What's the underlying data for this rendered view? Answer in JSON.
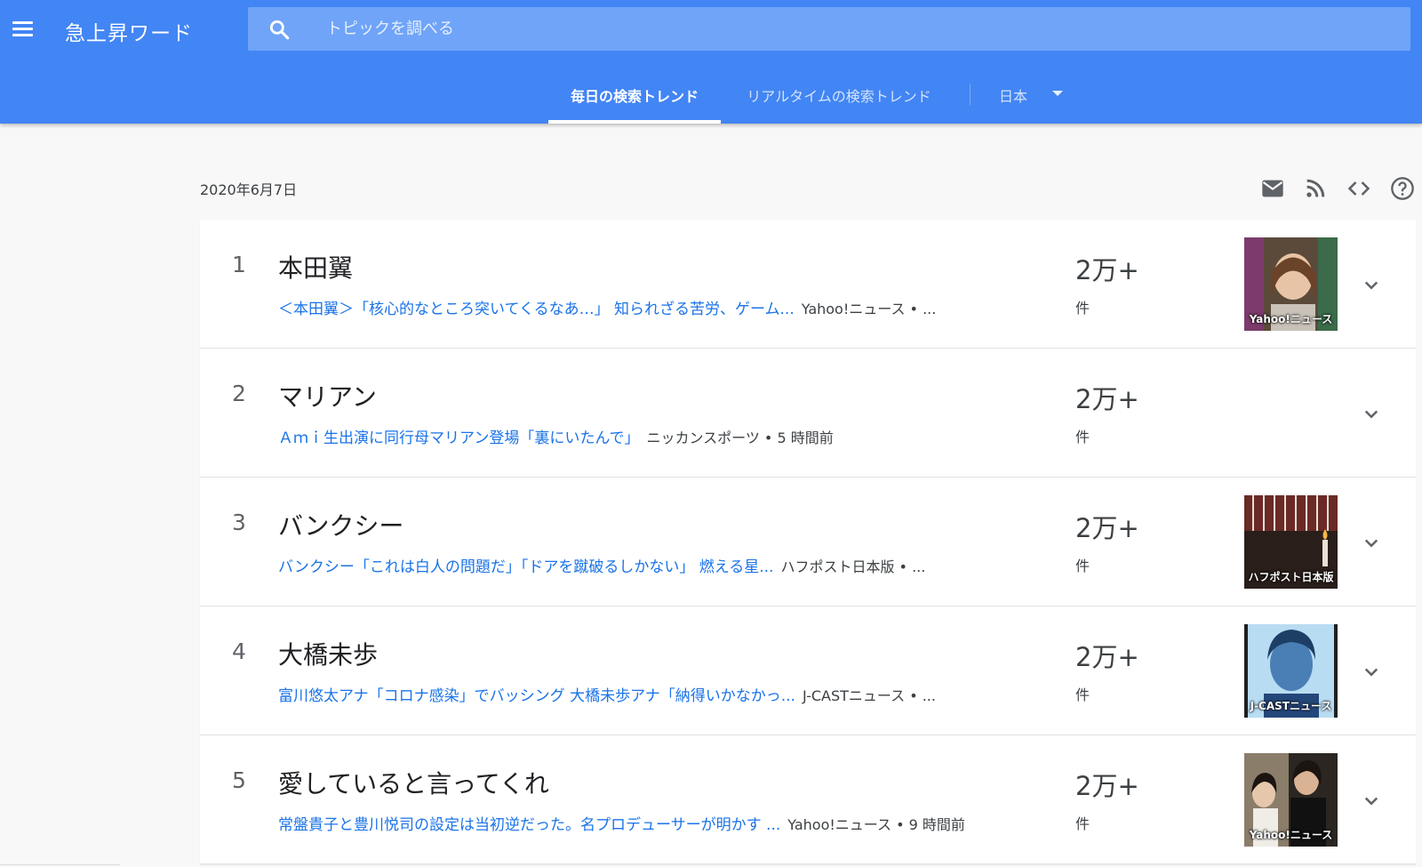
{
  "header": {
    "app_title": "急上昇ワード",
    "search_placeholder": "トピックを調べる",
    "menu_icon": "hamburger-menu-icon",
    "search_icon": "search-icon"
  },
  "tabs": [
    {
      "label": "毎日の検索トレンド",
      "active": true
    },
    {
      "label": "リアルタイムの検索トレンド",
      "active": false
    }
  ],
  "country": {
    "selected": "日本"
  },
  "date": "2020年6月7日",
  "tools": [
    "mail-icon",
    "rss-icon",
    "embed-code-icon",
    "help-icon"
  ],
  "colors": {
    "header": "#4285f4",
    "link": "#1a73e8",
    "search_bg": "#6fa4f8"
  },
  "trends": [
    {
      "rank": "1",
      "title": "本田翼",
      "article": "＜本田翼＞「核心的なところ突いてくるなあ…」 知られざる苦労、ゲーム...",
      "source": "Yahoo!ニュース • ...",
      "count": "2万+",
      "unit": "件",
      "thumb_label": "Yahoo!ニュース",
      "has_thumb": true
    },
    {
      "rank": "2",
      "title": "マリアン",
      "article": "Ａｍｉ生出演に同行母マリアン登場「裏にいたんで」",
      "source": "ニッカンスポーツ • 5 時間前",
      "count": "2万+",
      "unit": "件",
      "thumb_label": "",
      "has_thumb": false
    },
    {
      "rank": "3",
      "title": "バンクシー",
      "article": "バンクシー「これは白人の問題だ」「ドアを蹴破るしかない」 燃える星...",
      "source": "ハフポスト日本版 • ...",
      "count": "2万+",
      "unit": "件",
      "thumb_label": "ハフポスト日本版",
      "has_thumb": true
    },
    {
      "rank": "4",
      "title": "大橋未歩",
      "article": "富川悠太アナ「コロナ感染」でバッシング 大橋未歩アナ「納得いかなかっ...",
      "source": "J-CASTニュース • ...",
      "count": "2万+",
      "unit": "件",
      "thumb_label": "J-CASTニュース",
      "has_thumb": true
    },
    {
      "rank": "5",
      "title": "愛していると言ってくれ",
      "article": "常盤貴子と豊川悦司の設定は当初逆だった。名プロデューサーが明かす ...",
      "source": "Yahoo!ニュース • 9 時間前",
      "count": "2万+",
      "unit": "件",
      "thumb_label": "Yahoo!ニュース",
      "has_thumb": true
    }
  ]
}
